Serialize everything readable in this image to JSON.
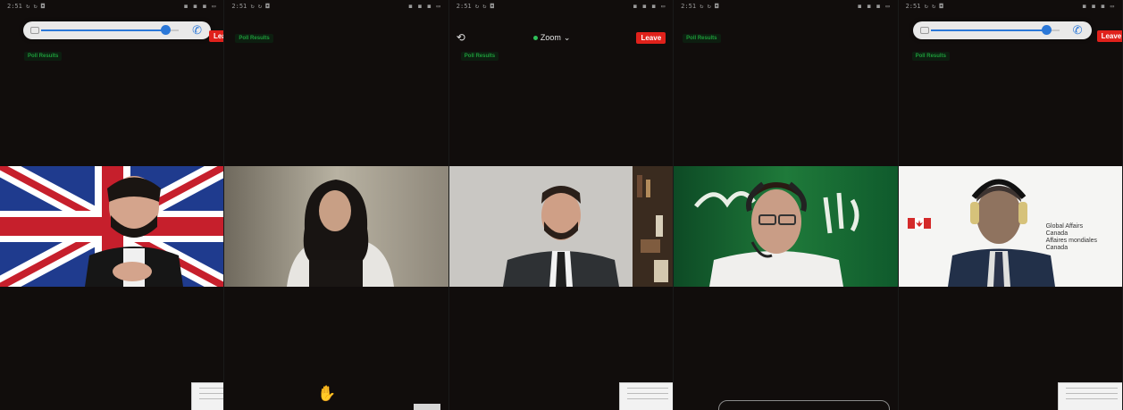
{
  "status_time": "2:51 ↻ ↻ ◘",
  "status_icons": "◼ ◼ ◼ ▭",
  "zoom_label": "Zoom",
  "leave_label": "Leave",
  "poll_label": "Poll Results",
  "panels": [
    {
      "name": "uk-flag-participant",
      "background": "UK flag"
    },
    {
      "name": "hijab-participant",
      "background": "plain room"
    },
    {
      "name": "suit-participant",
      "background": "office bookcase"
    },
    {
      "name": "saudi-flag-participant",
      "background": "Saudi flag"
    },
    {
      "name": "canada-participant",
      "background": "Global Affairs Canada"
    }
  ],
  "canada_text": [
    "Global Affairs",
    "Canada",
    "Affaires mondiales",
    "Canada"
  ],
  "colors": {
    "leave": "#e0211b",
    "zoom_dot": "#2fbf59",
    "volume": "#2b78d8"
  }
}
